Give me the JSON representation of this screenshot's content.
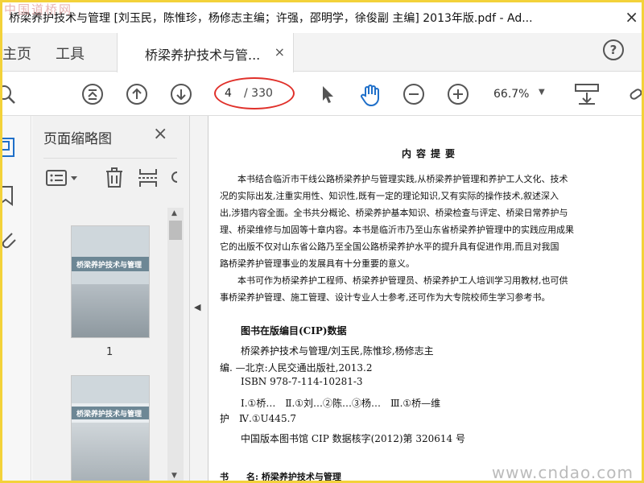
{
  "window": {
    "title": "桥梁养护技术与管理 [刘玉民，陈惟珍，杨修志主编；许强，邵明学，徐俊副 主编] 2013年版.pdf - Ad...",
    "watermark_top": "中国道桥网",
    "close_label": "×"
  },
  "tabs": {
    "home_label": "主页",
    "tools_label": "工具",
    "doc_tab_label": "桥梁养护技术与管...",
    "doc_tab_close": "×",
    "help_label": "?"
  },
  "toolbar": {
    "current_page": "4",
    "total_pages": "/ 330",
    "zoom_value": "66.7%"
  },
  "thumb_panel": {
    "title": "页面缩略图",
    "close_label": "×",
    "thumb1_title": "桥梁养护技术与管理",
    "thumb1_page": "1",
    "thumb2_title": "桥梁养护技术与管理"
  },
  "document": {
    "heading": "内容提要",
    "lines": [
      "　　本书结合临沂市干线公路桥梁养护与管理实践,从桥梁养护管理和养护工人文化、技术",
      "况的实际出发,注重实用性、知识性,既有一定的理论知识,又有实际的操作技术,叙述深入",
      "出,涉猎内容全面。全书共分概论、桥梁养护基本知识、桥梁检查与评定、桥梁日常养护与",
      "理、桥梁维修与加固等十章内容。本书是临沂市乃至山东省桥梁养护管理中的实践应用成果",
      "它的出版不仅对山东省公路乃至全国公路桥梁养护水平的提升具有促进作用,而且对我国",
      "路桥梁养护管理事业的发展具有十分重要的意义。",
      "　　本书可作为桥梁养护工程师、桥梁养护管理员、桥梁养护工人培训学习用教材,也可供",
      "事桥梁养护管理、施工管理、设计专业人士参考,还可作为大专院校师生学习参考书。"
    ],
    "cip_title": "图书在版编目(CIP)数据",
    "cip_line1": "桥梁养护技术与管理/刘玉民,陈惟珍,杨修志主",
    "cip_line2": "编. —北京:人民交通出版社,2013.2",
    "cip_line3": "ISBN 978-7-114-10281-3",
    "cip_line4": "Ⅰ.①桥…　Ⅱ.①刘…②陈…③杨…　Ⅲ.①桥—维",
    "cip_line5": "护　Ⅳ.①U445.7",
    "cip_line6": "中国版本图书馆 CIP 数据核字(2012)第 320614 号",
    "book_label": "书　　名: 桥梁养护技术与管理",
    "watermark_bottom": "www.cndao.com"
  }
}
